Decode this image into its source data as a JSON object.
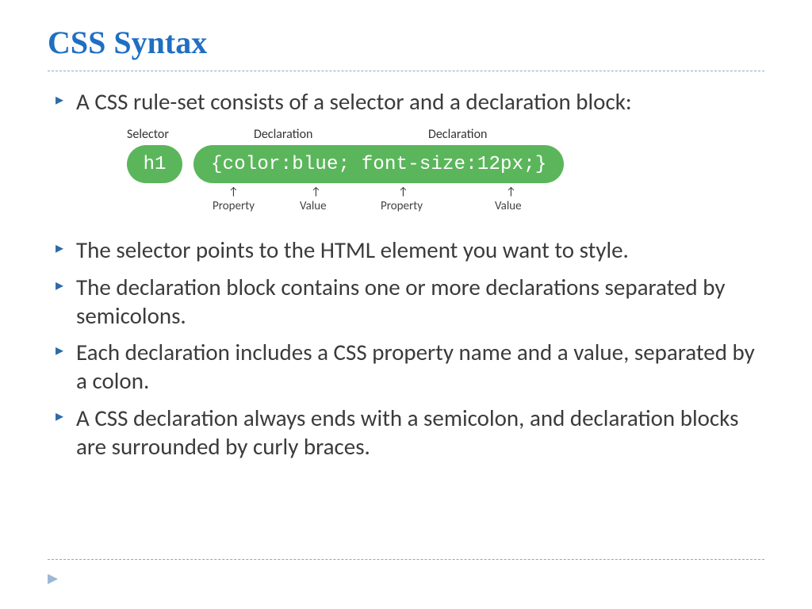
{
  "title": "CSS Syntax",
  "bullets": {
    "b0": "A CSS rule-set consists of a selector and a declaration block:",
    "b1": "The selector points to the HTML element you want to style.",
    "b2": "The declaration block contains one or more declarations separated by semicolons.",
    "b3": "Each declaration includes a CSS property name and a value, separated by a colon.",
    "b4": "A CSS declaration always ends with a semicolon, and declaration blocks are surrounded by curly braces."
  },
  "diagram": {
    "top_labels": {
      "selector": "Selector",
      "declaration1": "Declaration",
      "declaration2": "Declaration"
    },
    "selector_pill": "h1",
    "declaration_text": "{color:blue; font-size:12px;}",
    "bottom_labels": {
      "prop1": "Property",
      "val1": "Value",
      "prop2": "Property",
      "val2": "Value"
    }
  }
}
